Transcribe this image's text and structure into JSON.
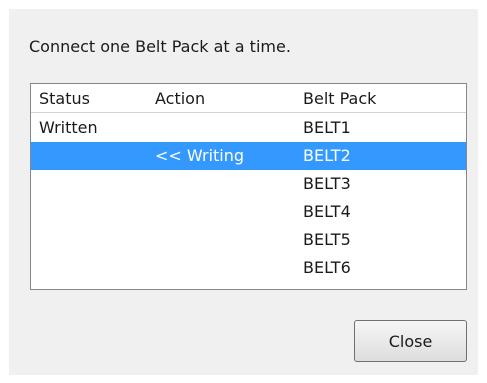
{
  "dialog": {
    "instruction": "Connect one Belt Pack at a time.",
    "columns": {
      "status": "Status",
      "action": "Action",
      "belt_pack": "Belt Pack"
    },
    "rows": [
      {
        "status": "Written",
        "action": "",
        "belt_pack": "BELT1",
        "selected": false
      },
      {
        "status": "",
        "action": "<< Writing",
        "belt_pack": "BELT2",
        "selected": true
      },
      {
        "status": "",
        "action": "",
        "belt_pack": "BELT3",
        "selected": false
      },
      {
        "status": "",
        "action": "",
        "belt_pack": "BELT4",
        "selected": false
      },
      {
        "status": "",
        "action": "",
        "belt_pack": "BELT5",
        "selected": false
      },
      {
        "status": "",
        "action": "",
        "belt_pack": "BELT6",
        "selected": false
      }
    ],
    "close_label": "Close",
    "selection_color": "#3399ff"
  }
}
